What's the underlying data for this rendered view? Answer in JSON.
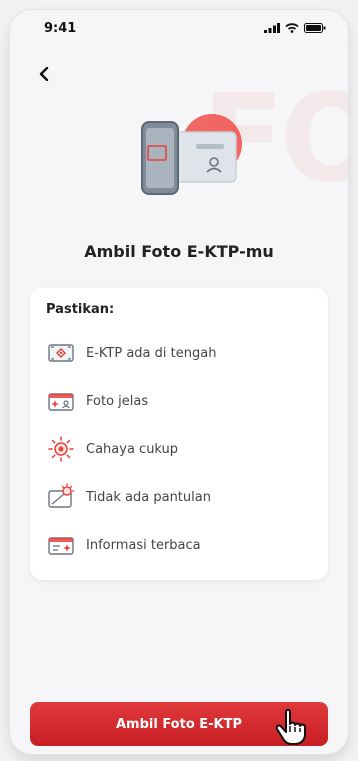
{
  "status_bar": {
    "time": "9:41"
  },
  "header": {
    "back_icon": "chevron-left-icon"
  },
  "watermark": "FO",
  "page_title": "Ambil Foto E-KTP-mu",
  "checklist": {
    "heading": "Pastikan:",
    "items": [
      {
        "label": "E-KTP ada di tengah",
        "icon": "center-frame-icon"
      },
      {
        "label": "Foto jelas",
        "icon": "clear-card-icon"
      },
      {
        "label": "Cahaya cukup",
        "icon": "sun-icon"
      },
      {
        "label": "Tidak ada pantulan",
        "icon": "no-reflection-icon"
      },
      {
        "label": "Informasi terbaca",
        "icon": "readable-card-icon"
      }
    ]
  },
  "cta": {
    "label": "Ambil Foto E-KTP"
  },
  "colors": {
    "accent": "#d9282f",
    "icon_red": "#e8403c"
  }
}
